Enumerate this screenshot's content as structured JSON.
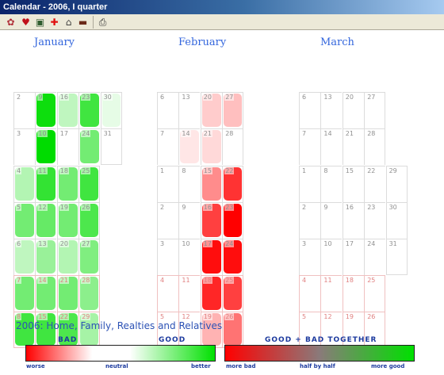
{
  "window": {
    "title": "Calendar - 2006, I quarter"
  },
  "toolbar": {
    "buttons": [
      {
        "name": "flowers-icon",
        "glyph": "✿",
        "color": "#b0303a"
      },
      {
        "name": "heart-icon",
        "glyph": "♥",
        "color": "#c0101a"
      },
      {
        "name": "monitor-icon",
        "glyph": "▣",
        "color": "#2f5d2f"
      },
      {
        "name": "red-cross-icon",
        "glyph": "✚",
        "color": "#e01010"
      },
      {
        "name": "house-icon",
        "glyph": "⌂",
        "color": "#404040"
      },
      {
        "name": "briefcase-icon",
        "glyph": "▬",
        "color": "#6b2a1a"
      },
      {
        "name": "printer-icon",
        "glyph": "⎙",
        "color": "#303030"
      }
    ]
  },
  "months": [
    {
      "name": "January",
      "weeks": [
        [
          null,
          2,
          3,
          4,
          5,
          6,
          7,
          8
        ],
        [
          null,
          9,
          10,
          11,
          12,
          13,
          14,
          15
        ],
        [
          null,
          16,
          17,
          18,
          19,
          20,
          21,
          22
        ],
        [
          null,
          23,
          24,
          25,
          26,
          27,
          28,
          29
        ],
        [
          null,
          30,
          31,
          null,
          null,
          null,
          null,
          null
        ]
      ],
      "levels": {
        "2": 0,
        "3": 0,
        "4": 0.3,
        "5": 0.55,
        "6": 0.25,
        "7": 0.55,
        "8": 0.75,
        "9": 0.95,
        "10": 1.0,
        "11": 0.8,
        "12": 0.6,
        "13": 0.4,
        "14": 0.55,
        "15": 0.75,
        "16": 0.25,
        "17": 0,
        "18": 0.55,
        "19": 0.55,
        "20": 0.3,
        "21": 0.55,
        "22": 0.7,
        "23": 0.75,
        "24": 0.55,
        "25": 0.75,
        "26": 0.7,
        "27": 0.5,
        "28": 0.45,
        "29": 0.35,
        "30": 0.1,
        "31": 0
      }
    },
    {
      "name": "February",
      "weeks": [
        [
          null,
          6,
          7,
          1,
          2,
          3,
          4,
          5
        ],
        [
          null,
          13,
          14,
          8,
          9,
          10,
          11,
          12
        ],
        [
          null,
          20,
          21,
          15,
          16,
          17,
          18,
          19
        ],
        [
          null,
          27,
          28,
          22,
          23,
          24,
          25,
          26
        ]
      ],
      "levels": {
        "1": 0,
        "2": 0,
        "3": 0,
        "4": 0,
        "5": 0,
        "6": 0,
        "7": 0,
        "8": 0,
        "9": 0,
        "10": 0,
        "11": 0,
        "12": 0,
        "13": 0,
        "14": -0.1,
        "15": -0.45,
        "16": -0.75,
        "17": -0.95,
        "18": -0.85,
        "19": -0.3,
        "20": -0.2,
        "21": -0.15,
        "22": -0.8,
        "23": -1.0,
        "24": -0.95,
        "25": -0.75,
        "26": -0.55,
        "27": -0.25,
        "28": 0
      }
    },
    {
      "name": "March",
      "weeks": [
        [
          null,
          6,
          7,
          1,
          2,
          3,
          4,
          5
        ],
        [
          null,
          13,
          14,
          8,
          9,
          10,
          11,
          12
        ],
        [
          null,
          20,
          21,
          15,
          16,
          17,
          18,
          19
        ],
        [
          null,
          27,
          28,
          22,
          23,
          24,
          25,
          26
        ],
        [
          null,
          null,
          null,
          29,
          30,
          31,
          null,
          null
        ]
      ],
      "levels": {}
    }
  ],
  "category": "2006: Home, Family, Realties and Relatives",
  "legend": {
    "bad_label": "BAD",
    "good_label": "GOOD",
    "together_label": "GOOD + BAD TOGETHER",
    "worse_label": "worse",
    "neutral_label": "neutral",
    "better_label": "better",
    "more_bad_label": "more bad",
    "half_label": "half by half",
    "more_good_label": "more good",
    "bad_color": "#ff0000",
    "good_color": "#00e000",
    "mixed_color": "#8a7a7a"
  }
}
